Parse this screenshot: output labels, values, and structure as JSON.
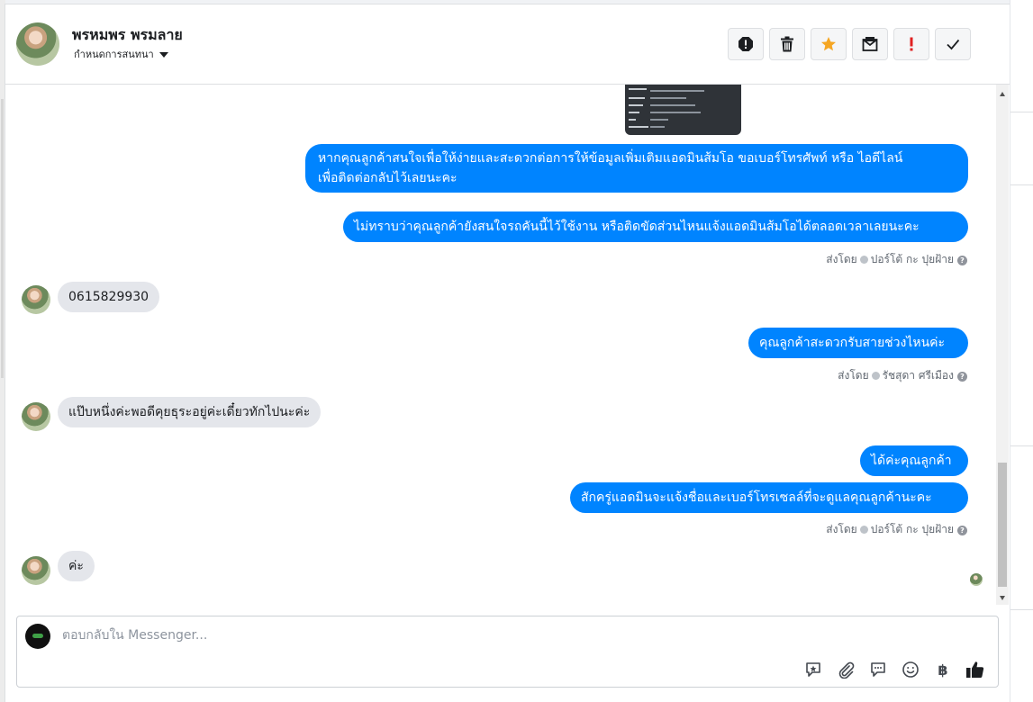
{
  "header": {
    "contact_name": "พรหมพร พรมลาย",
    "assign_label": "กำหนดการสนทนา",
    "actions": [
      {
        "icon": "spam-alert-icon"
      },
      {
        "icon": "trash-icon"
      },
      {
        "icon": "star-icon",
        "color": "#f5a623"
      },
      {
        "icon": "mark-unread-icon"
      },
      {
        "icon": "important-icon",
        "color": "#e02020"
      },
      {
        "icon": "check-done-icon"
      }
    ]
  },
  "messages": {
    "out_1": "หากคุณลูกค้าสนใจเพื่อให้ง่ายและสะดวกต่อการให้ข้อมูลเพิ่มเติมแอดมินส้มโอ ขอเบอร์โทรศัพท์ หรือ ไอดีไลน์",
    "out_1_line2": "เพื่อติดต่อกลับไว้เลยนะคะ",
    "out_2": "ไม่ทราบว่าคุณลูกค้ายังสนใจรถคันนี้ไว้ใช้งาน หรือติดขัดส่วนไหนแจ้งแอดมินส้มโอได้ตลอดเวลาเลยนะคะ",
    "sent_by_1_prefix": "ส่งโดย",
    "sent_by_1_name": "ปอร์โต้ กะ ปุยฝ้าย",
    "in_1": "0615829930",
    "out_3": "คุณลูกค้าสะดวกรับสายช่วงไหนค่ะ",
    "sent_by_2_prefix": "ส่งโดย",
    "sent_by_2_name": "รัชสุดา ศรีเมือง",
    "in_2": "แป๊บหนึ่งค่ะพอดีคุยธุระอยู่ค่ะเดี๋ยวทักไปนะค่ะ",
    "out_4": "ได้ค่ะคุณลูกค้า",
    "out_5": "สักครู่แอดมินจะแจ้งชื่อและเบอร์โทรเซลล์ที่จะดูแลคุณลูกค้านะคะ",
    "sent_by_3_prefix": "ส่งโดย",
    "sent_by_3_name": "ปอร์โต้ กะ ปุยฝ้าย",
    "in_3": "ค่ะ"
  },
  "composer": {
    "placeholder": "ตอบกลับใน Messenger...",
    "tools": [
      "quick-reply-icon",
      "attachment-icon",
      "saved-reply-icon",
      "emoji-icon",
      "baht-icon",
      "thumbs-up-icon"
    ],
    "baht_symbol": "฿"
  },
  "colors": {
    "outgoing_bubble": "#0084ff",
    "incoming_bubble": "#e4e6eb"
  }
}
